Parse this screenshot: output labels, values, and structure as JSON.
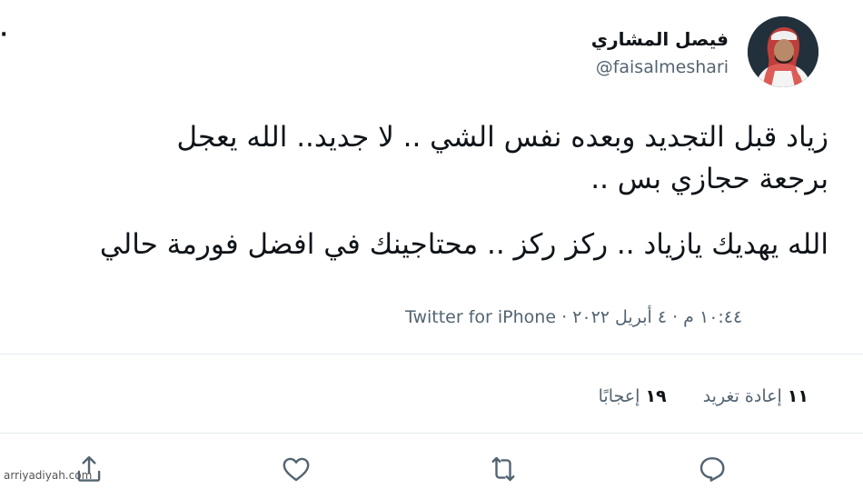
{
  "tweet": {
    "author": {
      "display_name": "فيصل المشاري",
      "handle": "@faisalmeshari"
    },
    "text_lines": [
      "زياد قبل التجديد وبعده نفس الشي .. لا جديد.. الله يعجل",
      "برجعة حجازي بس ..",
      "الله يهديك يازياد .. ركز ركز .. محتاجينك في افضل فورمة حالي"
    ],
    "meta": {
      "time": "١٠:٤٤ م",
      "date": "٤ أبريل ٢٠٢٢",
      "separator": "·",
      "source": "Twitter for iPhone"
    },
    "stats": {
      "retweets_count": "١١",
      "retweets_label": "إعادة تغريد",
      "likes_count": "١٩",
      "likes_label": "إعجابًا"
    },
    "more_icon": "more-dots-icon",
    "actions": [
      "reply-icon",
      "retweet-icon",
      "like-icon",
      "share-icon"
    ]
  },
  "watermark": "arriyadiyah.com",
  "colors": {
    "text": "#0f1419",
    "secondary": "#536471",
    "divider": "#e6ecf0"
  }
}
